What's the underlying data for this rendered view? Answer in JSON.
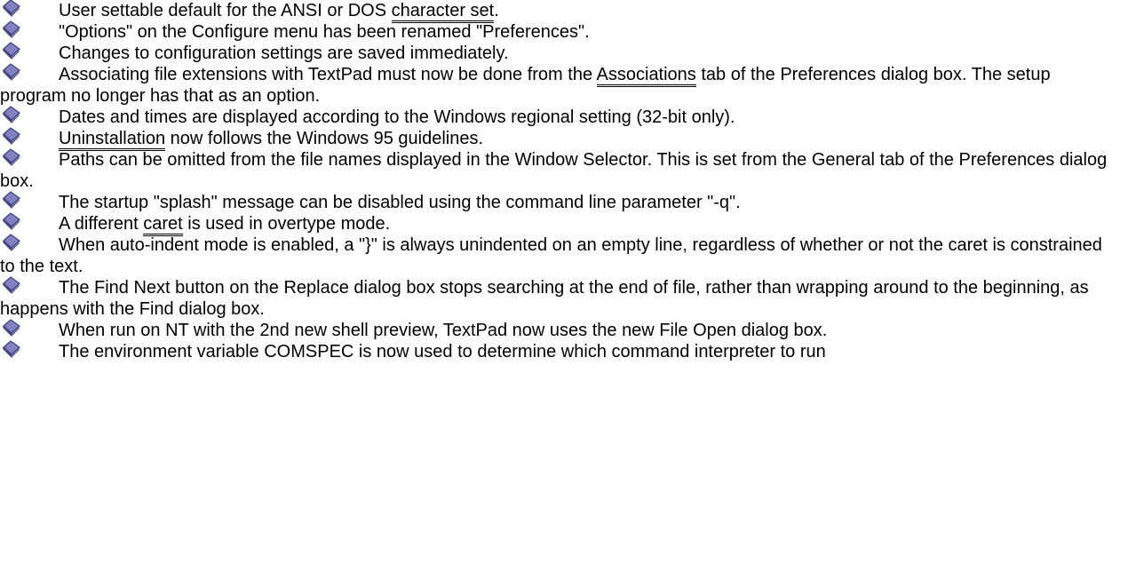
{
  "items": [
    {
      "parts": [
        {
          "t": "User settable default for the ANSI or DOS "
        },
        {
          "t": "character set",
          "link": true
        },
        {
          "t": "."
        }
      ]
    },
    {
      "parts": [
        {
          "t": "\"Options\" on the Configure menu has been renamed \"Preferences\"."
        }
      ]
    },
    {
      "parts": [
        {
          "t": "Changes to configuration settings are saved immediately."
        }
      ]
    },
    {
      "parts": [
        {
          "t": "Associating file extensions with TextPad must now be done from the "
        },
        {
          "t": "Associations",
          "link": true
        },
        {
          "t": " tab of the Preferences dialog box.   The setup program no longer has that as an option."
        }
      ]
    },
    {
      "parts": [
        {
          "t": "Dates and times are displayed according to the Windows regional setting (32-bit only)."
        }
      ]
    },
    {
      "parts": [
        {
          "t": "Uninstallation",
          "link": true
        },
        {
          "t": " now follows the Windows 95 guidelines."
        }
      ]
    },
    {
      "parts": [
        {
          "t": "Paths can be omitted from the file names displayed in the Window Selector.   This is set from the General tab of the Preferences dialog box."
        }
      ]
    },
    {
      "parts": [
        {
          "t": "The startup \"splash\" message can be disabled using the command line parameter \"-q\"."
        }
      ]
    },
    {
      "parts": [
        {
          "t": "A different "
        },
        {
          "t": "caret",
          "link": true
        },
        {
          "t": " is used in overtype mode."
        }
      ]
    },
    {
      "parts": [
        {
          "t": "When auto-indent mode is enabled, a \"}\" is always unindented on an empty line, regardless of whether or not the caret is constrained to the text."
        }
      ]
    },
    {
      "parts": [
        {
          "t": "The Find Next button on the Replace dialog box stops searching at the end of file, rather than wrapping around to the beginning, as happens with the Find dialog box."
        }
      ]
    },
    {
      "parts": [
        {
          "t": "When run on NT with the 2nd new shell preview, TextPad now uses the new File Open dialog box."
        }
      ]
    },
    {
      "parts": [
        {
          "t": "The environment variable COMSPEC is now used to determine which command interpreter to run"
        }
      ]
    }
  ],
  "bullet_icon": "book-icon",
  "colors": {
    "book_face": "#8080c0",
    "book_dark": "#404080",
    "book_page": "#ffffff",
    "text": "#000000"
  }
}
